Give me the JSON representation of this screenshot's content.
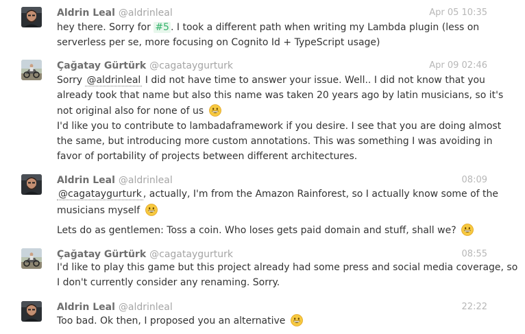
{
  "messages": [
    {
      "author": "Aldrin Leal",
      "handle": "@aldrinleal",
      "time": "Apr 05 10:35",
      "lines": {
        "l1_pre": "hey there. Sorry for",
        "l1_issue": "#5",
        "l1_post": ". I took a different path when writing my Lambda plugin (less on",
        "l2": "serverless per se, more focusing on Cognito Id + TypeScript usage)"
      }
    },
    {
      "author": "Çağatay Gürtürk",
      "handle": "@cagataygurturk",
      "time": "Apr 09 02:46",
      "lines": {
        "l1_pre": "Sorry",
        "l1_mention": "@aldrinleal",
        "l1_post": "I did not have time to answer your issue. Well.. I did not know that you",
        "l2": "already took that name but also this name was taken 20 years ago by latin musicians, so it's",
        "l3": "not original also for none of us",
        "l4": "I'd like you to contribute to lambadaframework if you desire. I see that you are doing almost",
        "l5": "the same, but introducing more custom annotations. This was something I was avoiding in",
        "l6": "favor of portability of projects between different architectures."
      }
    },
    {
      "author": "Aldrin Leal",
      "handle": "@aldrinleal",
      "time": "08:09",
      "lines": {
        "l1_mention": "@cagataygurturk",
        "l1_post": ", actually, I'm from the Amazon Rainforest, so I actually know some of the",
        "l2": "musicians myself",
        "l3": "Lets do as gentlemen: Toss a coin. Who loses gets paid domain and stuff, shall we?"
      }
    },
    {
      "author": "Çağatay Gürtürk",
      "handle": "@cagataygurturk",
      "time": "08:55",
      "lines": {
        "l1": "I'd like to play this game but this project already had some press and social media coverage, so",
        "l2": "I don't currently consider any renaming. Sorry."
      }
    },
    {
      "author": "Aldrin Leal",
      "handle": "@aldrinleal",
      "time": "22:22",
      "lines": {
        "l1": "Too bad. Ok then, I proposed you an alternative"
      }
    }
  ],
  "icons": {
    "emoji": "grinning-face-icon"
  },
  "colors": {
    "issue_bg": "#e7f7ec",
    "issue_fg": "#34b36b",
    "name": "#6e6e6e",
    "handle": "#a5a5a5",
    "time": "#b7b7b7"
  }
}
